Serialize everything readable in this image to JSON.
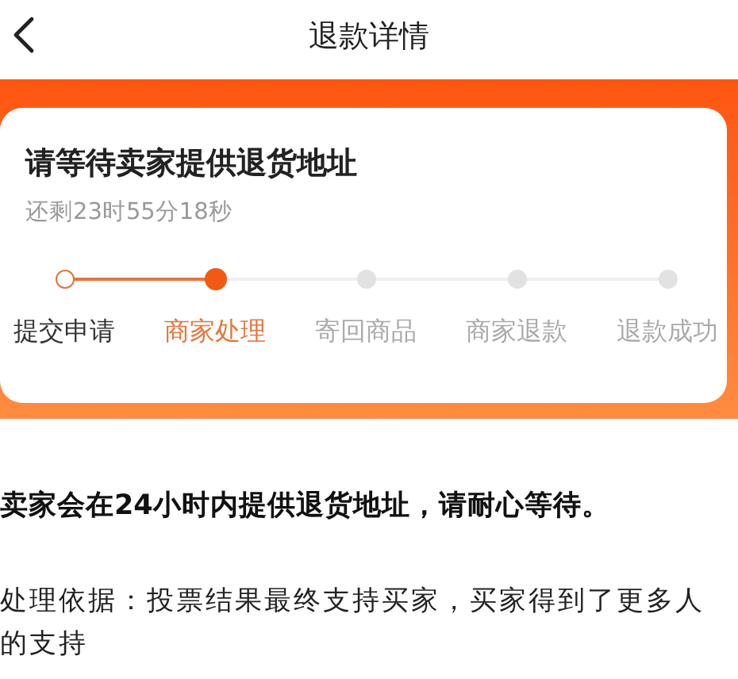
{
  "header": {
    "title": "退款详情"
  },
  "status": {
    "title": "请等待卖家提供退货地址",
    "countdown": "还剩23时55分18秒"
  },
  "steps": [
    {
      "label": "提交申请",
      "completed": true,
      "selected": false
    },
    {
      "label": "商家处理",
      "completed": false,
      "selected": true
    },
    {
      "label": "寄回商品",
      "completed": false,
      "selected": false
    },
    {
      "label": "商家退款",
      "completed": false,
      "selected": false
    },
    {
      "label": "退款成功",
      "completed": false,
      "selected": false
    }
  ],
  "notice": "卖家会在24小时内提供退货地址，请耐心等待。",
  "basis": "处理依据：投票结果最终支持买家，买家得到了更多人的支持"
}
